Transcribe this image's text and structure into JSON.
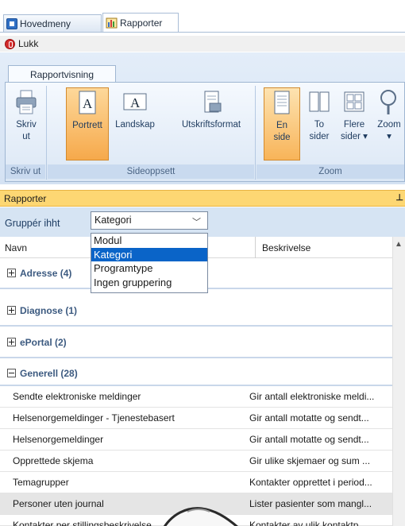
{
  "tabs": [
    {
      "label": "Hovedmeny",
      "icon": "home-menu-icon",
      "active": false
    },
    {
      "label": "Rapporter",
      "icon": "chart-report-icon",
      "active": true
    }
  ],
  "close_label": "Lukk",
  "ribbon": {
    "tab_label": "Rapportvisning",
    "groups": {
      "print": "Skriv ut",
      "page_setup": "Sideoppsett",
      "zoom": "Zoom"
    },
    "buttons": {
      "print_line1": "Skriv",
      "print_line2": "ut",
      "portrait": "Portrett",
      "landscape": "Landskap",
      "print_format": "Utskriftsformat",
      "one_page_line1": "En",
      "one_page_line2": "side",
      "two_pages_line1": "To",
      "two_pages_line2": "sider",
      "multi_pages_line1": "Flere",
      "multi_pages_line2": "sider",
      "zoom": "Zoom"
    }
  },
  "pane": {
    "title": "Rapporter",
    "group_by_label": "Gruppér ihht",
    "group_by_value": "Kategori",
    "group_options": [
      "Modul",
      "Kategori",
      "Programtype",
      "Ingen gruppering"
    ],
    "highlighted_option": "Kategori"
  },
  "grid": {
    "col_name": "Navn",
    "col_desc": "Beskrivelse",
    "groups": [
      {
        "label": "Adresse (4)",
        "expanded": false
      },
      {
        "label": "Diagnose (1)",
        "expanded": false
      },
      {
        "label": "ePortal (2)",
        "expanded": false
      },
      {
        "label": "Generell (28)",
        "expanded": true
      }
    ],
    "rows": [
      {
        "name": "Sendte elektroniske meldinger",
        "desc": "Gir antall elektroniske meldi..."
      },
      {
        "name": "Helsenorgemeldinger - Tjenestebasert",
        "desc": "Gir antall motatte og sendt..."
      },
      {
        "name": "Helsenorgemeldinger",
        "desc": "Gir antall motatte og sendt..."
      },
      {
        "name": "Opprettede skjema",
        "desc": "Gir ulike skjemaer og sum ..."
      },
      {
        "name": "Temagrupper",
        "desc": "Kontakter opprettet i period..."
      },
      {
        "name": "Personer uten journal",
        "desc": "Lister pasienter som mangl..."
      },
      {
        "name": "Kontakter per stillingsbeskrivelse",
        "desc": "Kontakter av ulik kontaktp..."
      }
    ],
    "selected_row": "Personer uten journal"
  },
  "colors": {
    "ribbon_bg": "#dbe7f5",
    "selected_button": "#f6a94b",
    "pane_header": "#fdd773",
    "dropdown_highlight": "#0a64c8",
    "group_text": "#3c5a80"
  }
}
